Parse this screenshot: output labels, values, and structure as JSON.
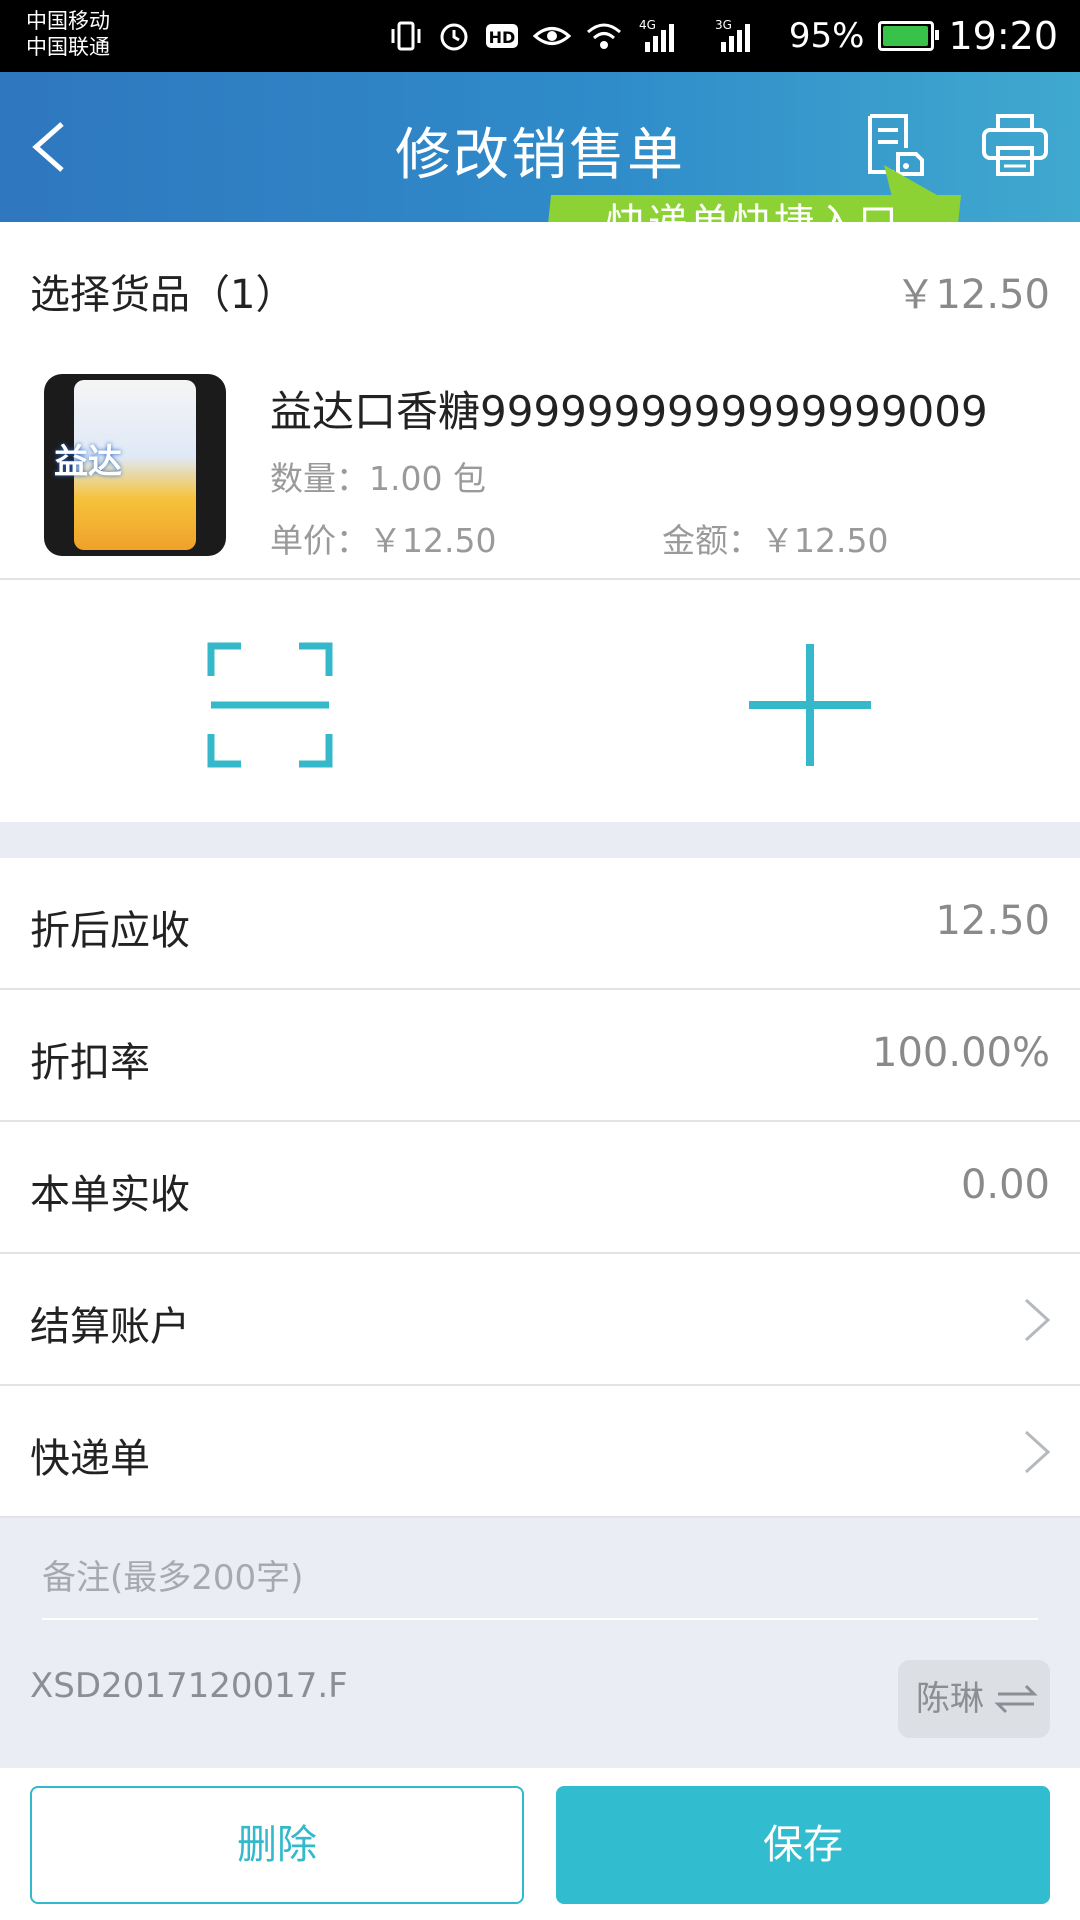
{
  "status_bar": {
    "carrier_1": "中国移动",
    "carrier_2": "中国联通",
    "network_1": "4G",
    "network_2": "3G",
    "battery": "95%",
    "time": "19:20",
    "icons": [
      "vibrate-icon",
      "alarm-icon",
      "hd-icon",
      "eye-icon",
      "wifi-icon",
      "signal-icon",
      "battery-icon"
    ]
  },
  "header": {
    "title": "修改销售单",
    "tooltip": "快递单快捷入口",
    "colors": {
      "bar_start": "#2f77bf",
      "bar_end": "#40a9cf",
      "tooltip": "#8cd235"
    }
  },
  "goods": {
    "label": "选择货品（1）",
    "total": "￥12.50",
    "items": [
      {
        "name": "益达口香糖9999999999999999009",
        "image_text": "益达",
        "quantity": "数量：1.00 包",
        "unit_price": "单价：￥12.50",
        "amount": "金额：￥12.50"
      }
    ]
  },
  "summary": {
    "discounted_receivable_label": "折后应收",
    "discounted_receivable_value": "12.50",
    "discount_rate_label": "折扣率",
    "discount_rate_value": "100.00%",
    "actual_received_label": "本单实收",
    "actual_received_value": "0.00",
    "settlement_account_label": "结算账户",
    "express_label": "快递单"
  },
  "remark": {
    "placeholder": "备注(最多200字)"
  },
  "order": {
    "number": "XSD2017120017.F",
    "user": "陈琳"
  },
  "footer": {
    "delete_label": "删除",
    "save_label": "保存",
    "accent": "#32bccf"
  }
}
